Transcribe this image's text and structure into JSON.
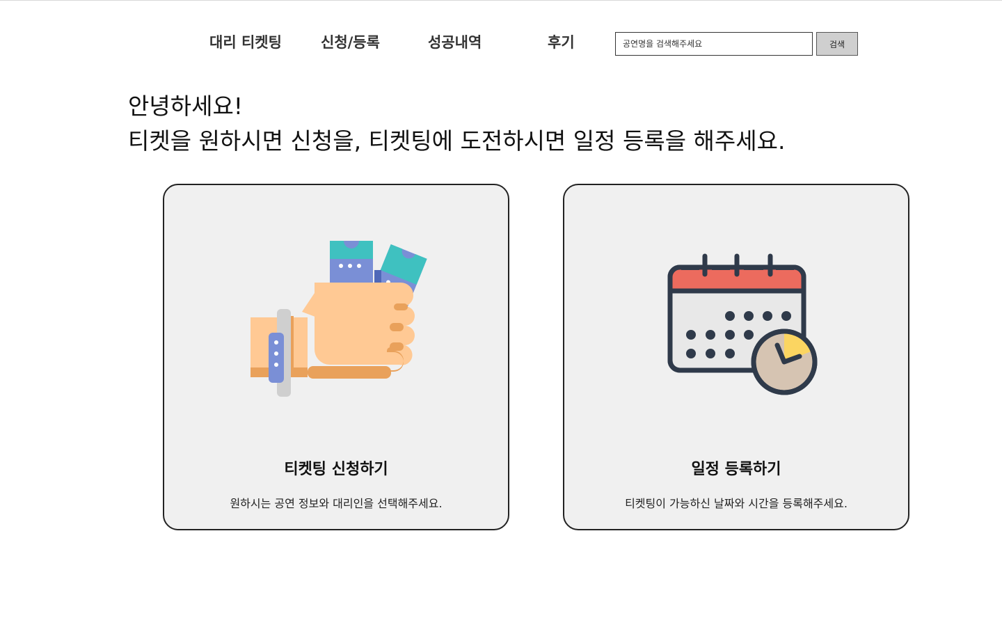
{
  "nav": {
    "items": [
      {
        "label": "대리 티켓팅"
      },
      {
        "label": "신청/등록"
      },
      {
        "label": "성공내역"
      },
      {
        "label": "후기"
      }
    ]
  },
  "search": {
    "placeholder": "공연명을 검색해주세요",
    "button_label": "검색"
  },
  "greeting": {
    "line1": "안녕하세요!",
    "line2": "티켓을 원하시면 신청을, 티켓팅에 도전하시면 일정 등록을 해주세요."
  },
  "cards": [
    {
      "title": "티켓팅 신청하기",
      "description": "원하시는 공연 정보와 대리인을 선택해주세요.",
      "icon": "hand-holding-tickets-icon"
    },
    {
      "title": "일정 등록하기",
      "description": "티켓팅이 가능하신 날짜와 시간을 등록해주세요.",
      "icon": "calendar-clock-icon"
    }
  ],
  "colors": {
    "card_bg": "#f0f0f0",
    "ticket_teal": "#3fc1c0",
    "ticket_blue": "#7a8fd6",
    "skin": "#ffc994",
    "skin_shadow": "#e9a15b",
    "calendar_red": "#ec6b5e",
    "calendar_dark": "#2f3a4a",
    "clock_yellow": "#fbd561"
  }
}
